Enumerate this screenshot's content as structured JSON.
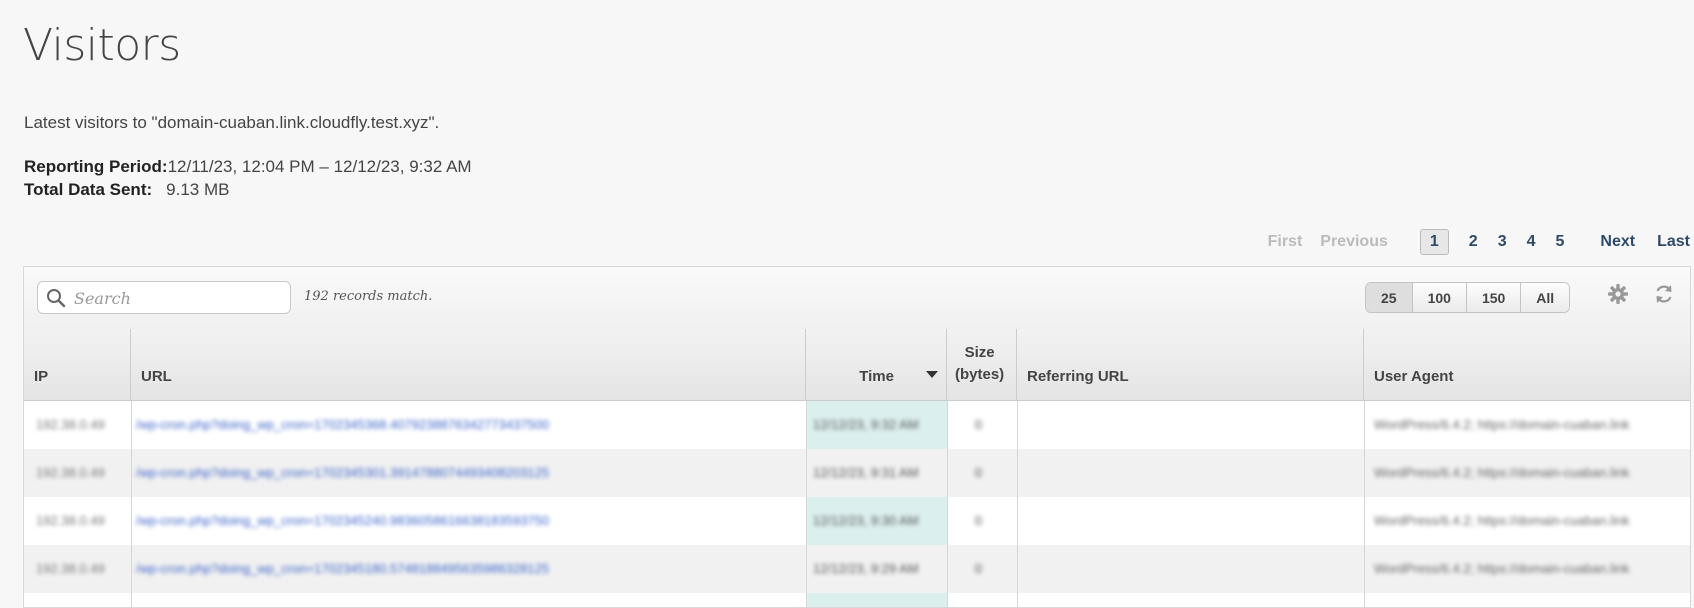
{
  "page": {
    "title": "Visitors",
    "latest_text": "Latest visitors to \"domain-cuaban.link.cloudfly.test.xyz\".",
    "reporting_label": "Reporting Period:",
    "reporting_value": "12/11/23, 12:04 PM  –  12/12/23, 9:32 AM",
    "total_label": "Total Data Sent:",
    "total_value": "9.13 MB"
  },
  "pagination": {
    "first": "First",
    "previous": "Previous",
    "pages": [
      "1",
      "2",
      "3",
      "4",
      "5"
    ],
    "current": "1",
    "next": "Next",
    "last": "Last"
  },
  "toolbar": {
    "search_placeholder": "Search",
    "records_text": "192 records match.",
    "page_sizes": [
      "25",
      "100",
      "150",
      "All"
    ],
    "selected_page_size": "25",
    "settings_icon": "gear-icon",
    "refresh_icon": "refresh-icon"
  },
  "table": {
    "columns": {
      "ip": "IP",
      "url": "URL",
      "time": "Time",
      "size_line1": "Size",
      "size_line2": "(bytes)",
      "referring": "Referring URL",
      "agent": "User Agent"
    },
    "sort_column": "Time",
    "sort_direction": "descending",
    "rows": [
      {
        "ip": "192.38.0.49",
        "url": "/wp-cron.php?doing_wp_cron=1702345368.4079238876342773437500",
        "time": "12/12/23, 9:32 AM",
        "size": "0",
        "referrer": "",
        "agent": "WordPress/6.4.2; https://domain-cuaban.link"
      },
      {
        "ip": "192.38.0.49",
        "url": "/wp-cron.php?doing_wp_cron=1702345301.3914788074493408203125",
        "time": "12/12/23, 9:31 AM",
        "size": "0",
        "referrer": "",
        "agent": "WordPress/6.4.2; https://domain-cuaban.link"
      },
      {
        "ip": "192.38.0.49",
        "url": "/wp-cron.php?doing_wp_cron=1702345240.9836058616638183593750",
        "time": "12/12/23, 9:30 AM",
        "size": "0",
        "referrer": "",
        "agent": "WordPress/6.4.2; https://domain-cuaban.link"
      },
      {
        "ip": "192.38.0.49",
        "url": "/wp-cron.php?doing_wp_cron=1702345180.5748188495635986328125",
        "time": "12/12/23, 9:29 AM",
        "size": "0",
        "referrer": "",
        "agent": "WordPress/6.4.2; https://domain-cuaban.link"
      }
    ]
  }
}
